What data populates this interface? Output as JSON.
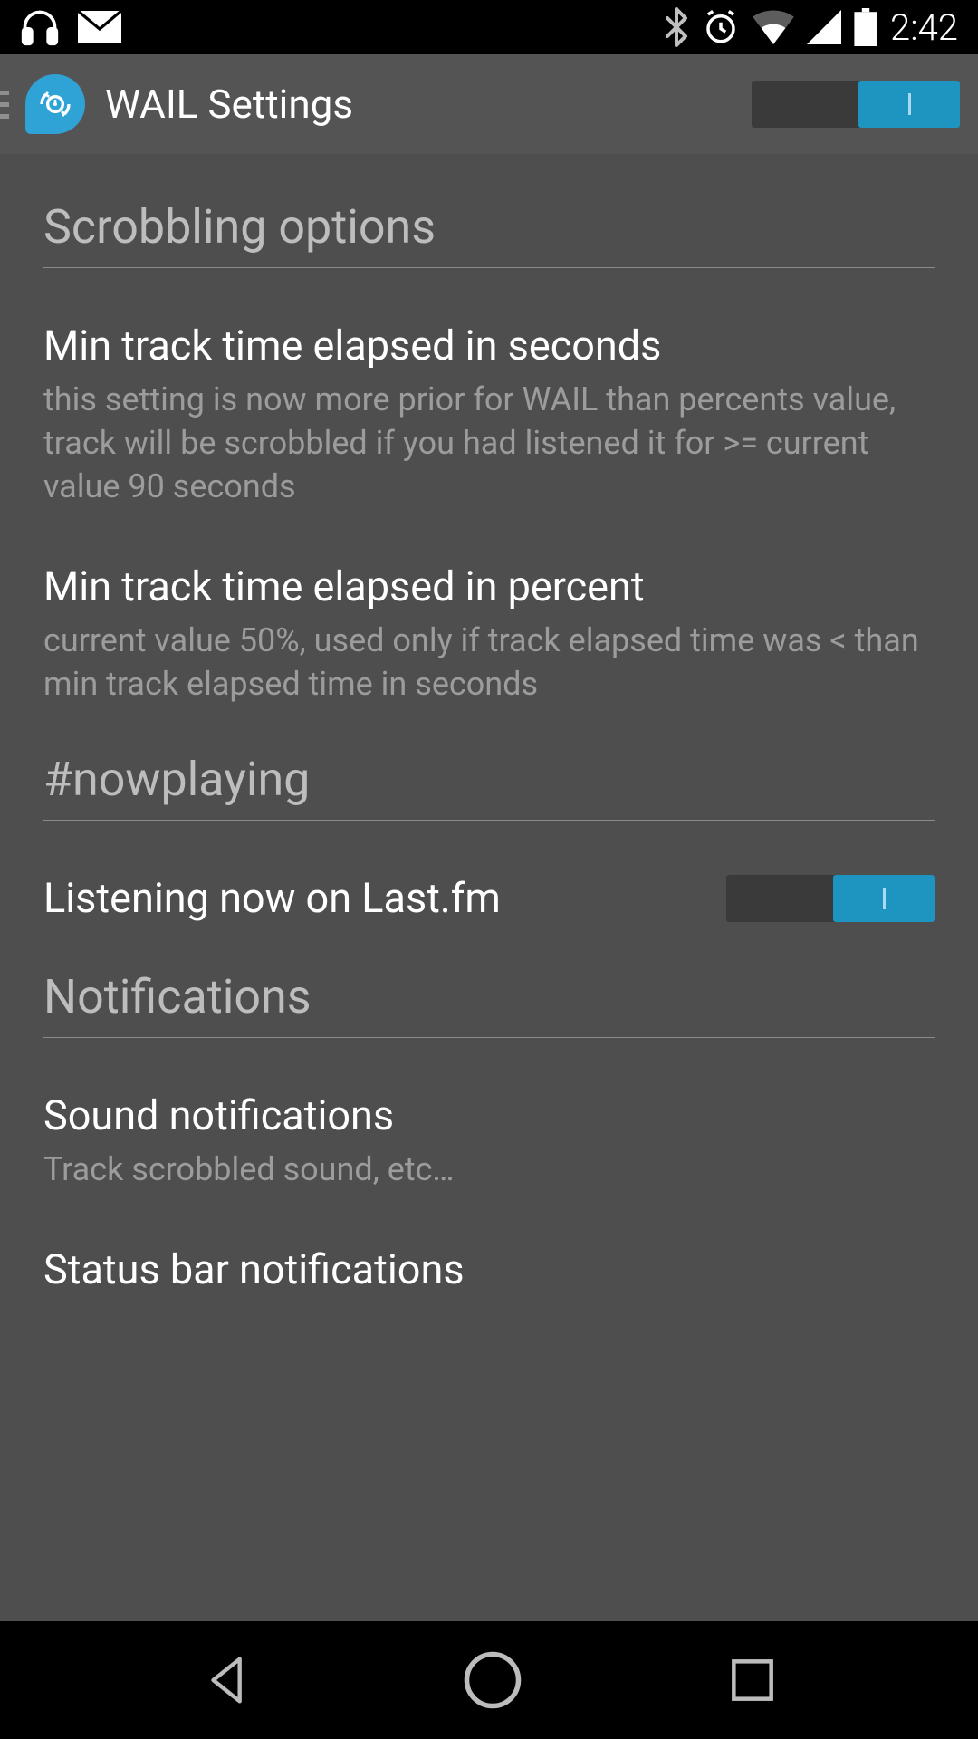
{
  "status": {
    "clock": "2:42"
  },
  "actionBar": {
    "title": "WAIL Settings",
    "masterToggleOn": true
  },
  "sections": {
    "scrobbling": {
      "header": "Scrobbling options",
      "minSeconds": {
        "title": "Min track time elapsed in seconds",
        "sub": "this setting is now more prior for WAIL than percents value, track will be scrobbled if you had listened it for >= current value 90 seconds"
      },
      "minPercent": {
        "title": "Min track time elapsed in percent",
        "sub": "current value 50%, used only if track elapsed time was < than min track elapsed time in seconds"
      }
    },
    "nowPlaying": {
      "header": "#nowplaying",
      "listeningNow": {
        "title": "Listening now on Last.fm",
        "on": true
      }
    },
    "notifications": {
      "header": "Notifications",
      "sound": {
        "title": "Sound notifications",
        "sub": "Track scrobbled sound, etc…"
      },
      "statusBar": {
        "title": "Status bar notifications"
      }
    }
  }
}
